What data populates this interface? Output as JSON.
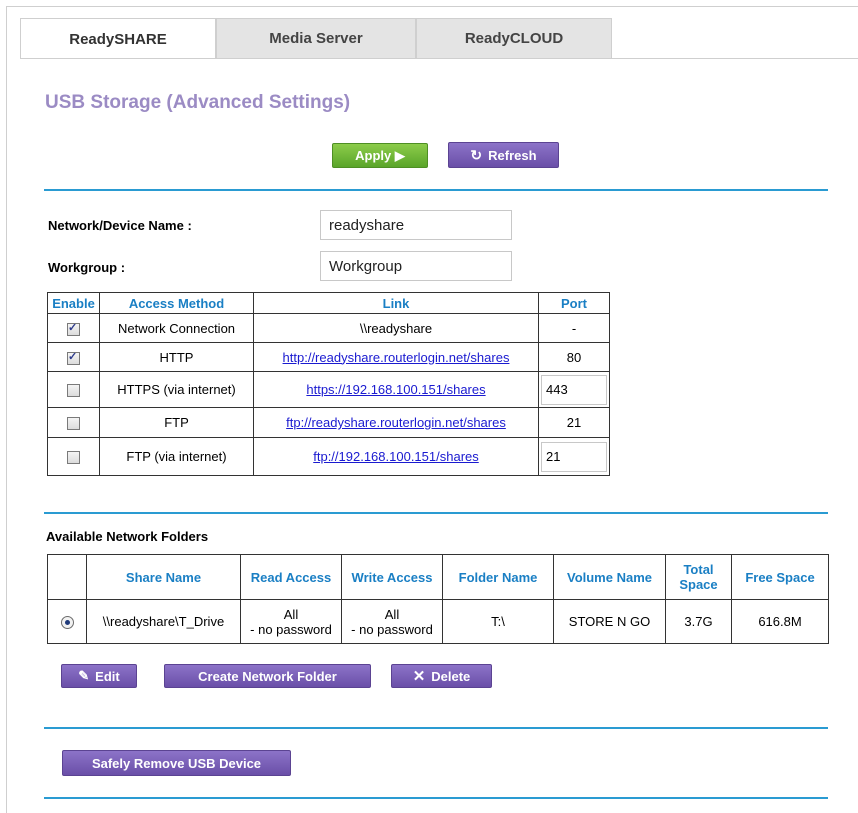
{
  "tabs": [
    {
      "label": "ReadySHARE",
      "active": true
    },
    {
      "label": "Media Server",
      "active": false
    },
    {
      "label": "ReadyCLOUD",
      "active": false
    }
  ],
  "page_title": "USB Storage (Advanced Settings)",
  "toolbar": {
    "apply_label": "Apply ▶",
    "refresh_label": "Refresh",
    "refresh_icon": "refresh-icon"
  },
  "form": {
    "device_name_label": "Network/Device Name :",
    "device_name_value": "readyshare",
    "workgroup_label": "Workgroup :",
    "workgroup_value": "Workgroup"
  },
  "access_table": {
    "headers": {
      "enable": "Enable",
      "method": "Access Method",
      "link": "Link",
      "port": "Port"
    },
    "rows": [
      {
        "checked": true,
        "method": "Network Connection",
        "link": "\\\\readyshare",
        "is_link": false,
        "port": "-",
        "port_editable": false
      },
      {
        "checked": true,
        "method": "HTTP",
        "link": "http://readyshare.routerlogin.net/shares",
        "is_link": true,
        "port": "80",
        "port_editable": false
      },
      {
        "checked": false,
        "method": "HTTPS (via internet)",
        "link": "https://192.168.100.151/shares",
        "is_link": true,
        "port": "443",
        "port_editable": true
      },
      {
        "checked": false,
        "method": "FTP",
        "link": "ftp://readyshare.routerlogin.net/shares",
        "is_link": true,
        "port": "21",
        "port_editable": false
      },
      {
        "checked": false,
        "method": "FTP (via internet)",
        "link": "ftp://192.168.100.151/shares",
        "is_link": true,
        "port": "21",
        "port_editable": true
      }
    ]
  },
  "folders": {
    "section_title": "Available Network Folders",
    "headers": {
      "share": "Share Name",
      "read": "Read Access",
      "write": "Write Access",
      "folder": "Folder Name",
      "volume": "Volume Name",
      "total": "Total Space",
      "free": "Free Space"
    },
    "rows": [
      {
        "selected": true,
        "share": "\\\\readyshare\\T_Drive",
        "read_line1": "All",
        "read_line2": "- no password",
        "write_line1": "All",
        "write_line2": "- no password",
        "folder": "T:\\",
        "volume": "STORE N GO",
        "total": "3.7G",
        "free": "616.8M"
      }
    ],
    "edit_label": "Edit",
    "create_label": "Create Network Folder",
    "delete_label": "Delete"
  },
  "safely_remove_label": "Safely Remove USB Device",
  "colors": {
    "accent_blue": "#2a9bd2",
    "purple_button": "#6a4fa8",
    "green_button": "#5aa52a",
    "title_purple": "#9b8bc4",
    "header_blue": "#1a7fc4"
  }
}
